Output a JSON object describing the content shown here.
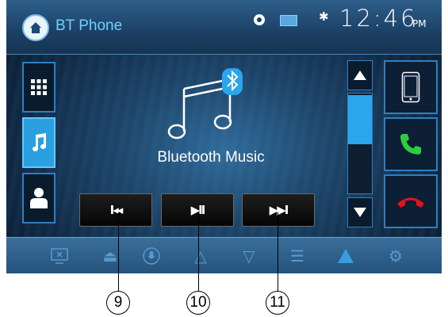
{
  "header": {
    "title": "BT Phone",
    "time": "12:46",
    "ampm": "PM"
  },
  "main": {
    "label": "Bluetooth Music"
  },
  "sidebar": {
    "items": [
      {
        "icon": "keypad-icon"
      },
      {
        "icon": "music-note-icon",
        "active": true
      },
      {
        "icon": "contacts-icon"
      }
    ]
  },
  "playback": {
    "prev_label": "I◂◂",
    "play_label": "▶II",
    "next_label": "▶▶I"
  },
  "callouts": {
    "c9": "9",
    "c10": "10",
    "c11": "11"
  },
  "colors": {
    "accent": "#2aa0e0",
    "call_green": "#2ecc40",
    "call_red": "#e8101e"
  }
}
